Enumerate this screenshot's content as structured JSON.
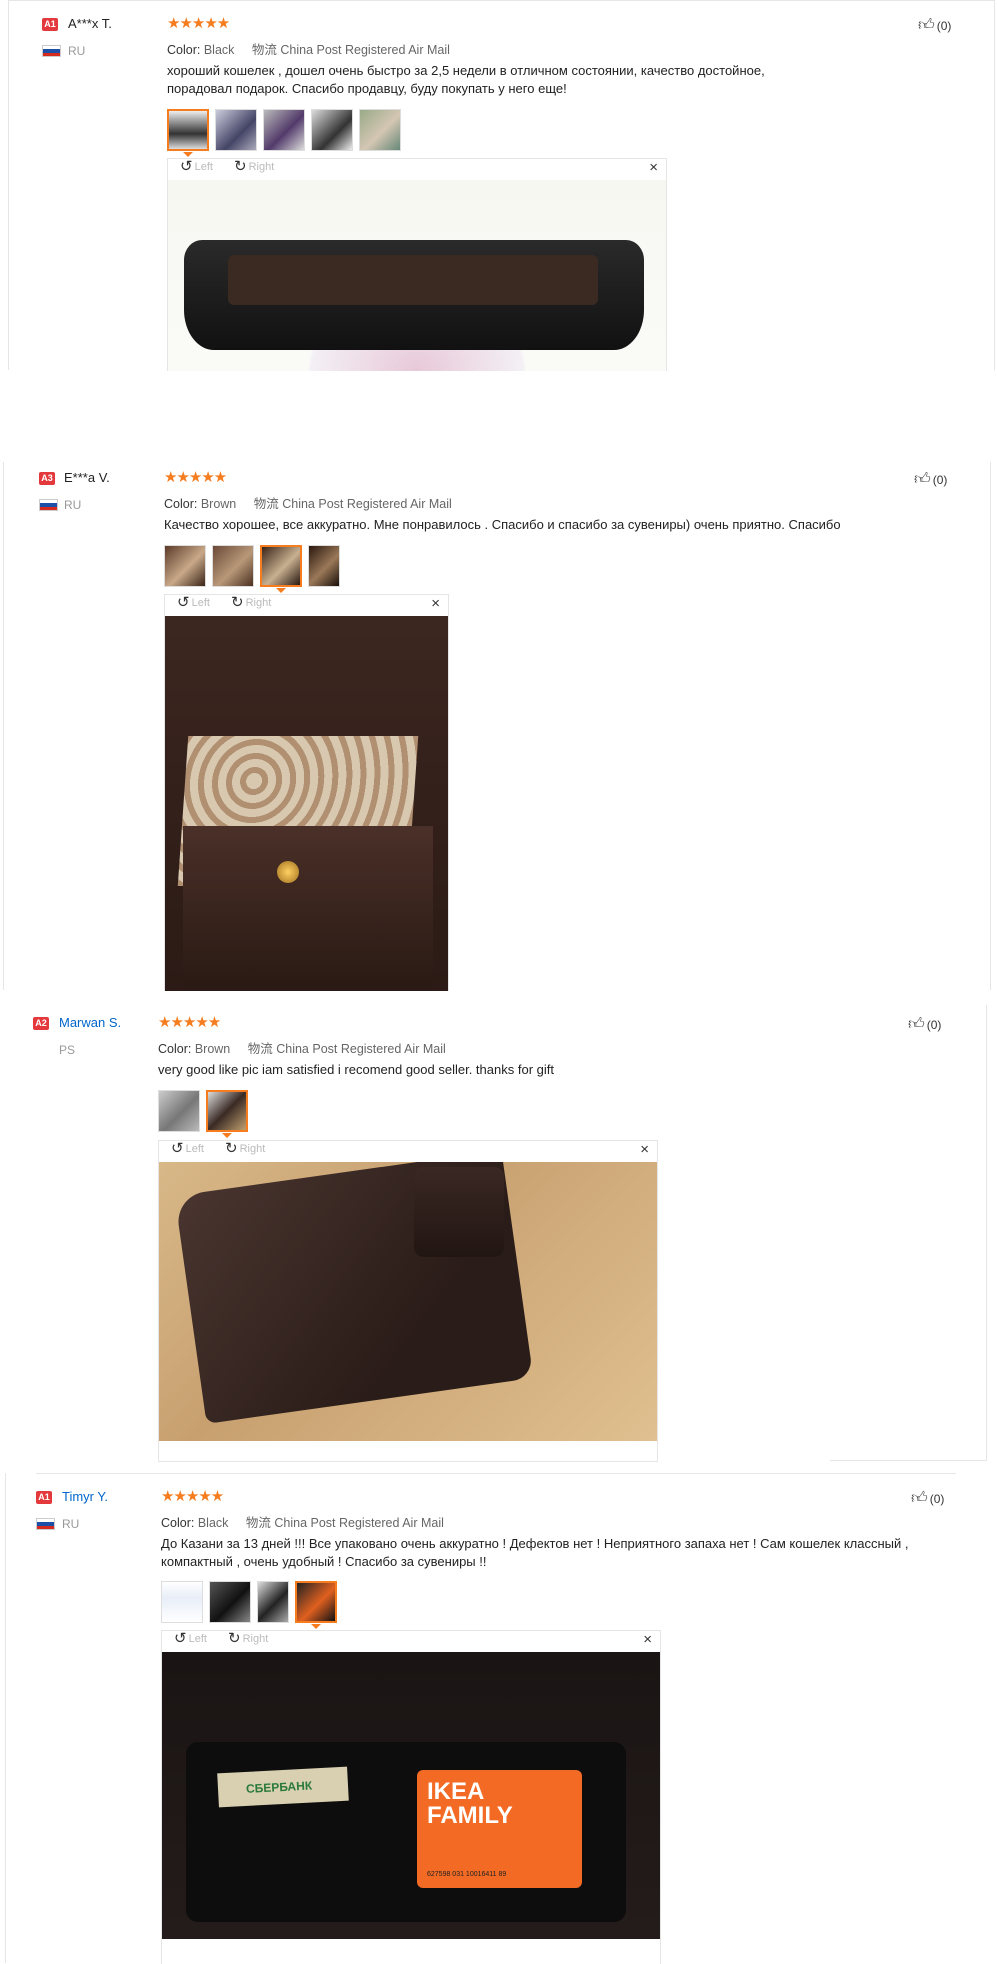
{
  "reviews": [
    {
      "badge": "A1",
      "name": "A***x T.",
      "country": "RU",
      "stars": "★★★★★",
      "color_label": "Color:",
      "color_value": "Black",
      "shipping": "物流 China Post Registered Air Mail",
      "text": "хороший кошелек , дошел очень быстро за 2,5 недели в отличном состоянии, качество достойное, порадовал подарок. Спасибо продавцу, буду покупать у него еще!",
      "likes": "(0)",
      "rotate_left": "Left",
      "rotate_right": "Right",
      "close": "×"
    },
    {
      "badge": "A3",
      "name": "E***a V.",
      "country": "RU",
      "stars": "★★★★★",
      "color_label": "Color:",
      "color_value": "Brown",
      "shipping": "物流 China Post Registered Air Mail",
      "text": "Качество хорошее, все аккуратно. Мне понравилось . Спасибо и спасибо за сувениры) очень приятно. Спасибо",
      "likes": "(0)",
      "rotate_left": "Left",
      "rotate_right": "Right",
      "close": "×"
    },
    {
      "badge": "A2",
      "name": "Marwan S.",
      "country": "PS",
      "stars": "★★★★★",
      "color_label": "Color:",
      "color_value": "Brown",
      "shipping": "物流 China Post Registered Air Mail",
      "text": "very good like pic iam satisfied i recomend good seller. thanks for gift",
      "likes": "(0)",
      "rotate_left": "Left",
      "rotate_right": "Right",
      "close": "×"
    },
    {
      "badge": "A1",
      "name": "Timyr Y.",
      "country": "RU",
      "stars": "★★★★★",
      "color_label": "Color:",
      "color_value": "Black",
      "shipping": "物流 China Post Registered Air Mail",
      "text": "До Казани за 13 дней !!! Все упаковано очень аккуратно ! Дефектов нет ! Неприятного запаха нет ! Сам кошелек классный , компактный , очень удобный ! Спасибо за сувениры !!",
      "likes": "(0)",
      "rotate_left": "Left",
      "rotate_right": "Right",
      "close": "×",
      "photo_card_brand": "IKEA FAMILY",
      "photo_card_number": "627598 031 10016411 89",
      "photo_bank_card": "СБЕРБАНК"
    }
  ],
  "colors": {
    "accent": "#f57c1f",
    "link": "#0066cc",
    "badge": "#e4393c"
  }
}
